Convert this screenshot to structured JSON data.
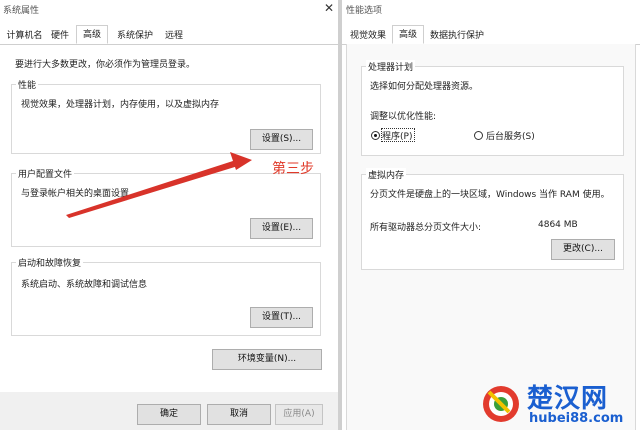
{
  "left_window": {
    "title": "系统属性",
    "close": "✕",
    "tabs": [
      "计算机名",
      "硬件",
      "高级",
      "系统保护",
      "远程"
    ],
    "admin_note": "要进行大多数更改，你必须作为管理员登录。",
    "performance": {
      "legend": "性能",
      "desc": "视觉效果，处理器计划，内存使用，以及虚拟内存",
      "button": "设置(S)..."
    },
    "user_profile": {
      "legend": "用户配置文件",
      "desc": "与登录帐户相关的桌面设置",
      "button": "设置(E)..."
    },
    "startup": {
      "legend": "启动和故障恢复",
      "desc": "系统启动、系统故障和调试信息",
      "button": "设置(T)..."
    },
    "env_button": "环境变量(N)...",
    "ok": "确定",
    "cancel": "取消",
    "apply": "应用(A)"
  },
  "annotation": {
    "text": "第三步",
    "color": "#e03a2a"
  },
  "right_window": {
    "title": "性能选项",
    "tabs": [
      "视觉效果",
      "高级",
      "数据执行保护"
    ],
    "processor": {
      "legend": "处理器计划",
      "desc": "选择如何分配处理器资源。",
      "adjust": "调整以优化性能:",
      "opt_programs": "程序(P)",
      "opt_background": "后台服务(S)"
    },
    "virtual_memory": {
      "legend": "虚拟内存",
      "desc": "分页文件是硬盘上的一块区域，Windows 当作 RAM 使用。",
      "total_label": "所有驱动器总分页文件大小:",
      "total_value": "4864 MB",
      "change_button": "更改(C)..."
    }
  },
  "watermark": {
    "cn": "楚汉网",
    "url": "hubei88.com",
    "color": "#1a5fd0"
  }
}
